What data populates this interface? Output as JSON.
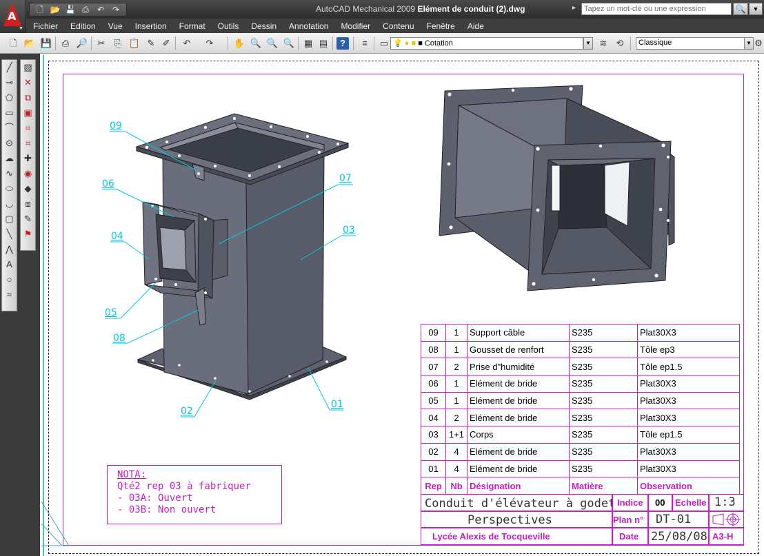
{
  "window": {
    "app_name": "AutoCAD Mechanical 2009",
    "file_name": "Elément de conduit (2).dwg",
    "search_placeholder": "Tapez un mot-clé ou une expression"
  },
  "menu": [
    "Fichier",
    "Edition",
    "Vue",
    "Insertion",
    "Format",
    "Outils",
    "Dessin",
    "Annotation",
    "Modifier",
    "Contenu",
    "Fenêtre",
    "Aide"
  ],
  "toolbar": {
    "layer_combo": "Cotation",
    "style_combo": "Classique"
  },
  "callouts": [
    "09",
    "06",
    "04",
    "05",
    "08",
    "07",
    "03",
    "02",
    "01"
  ],
  "nota": {
    "title": "NOTA:",
    "lines": [
      "Qté2 rep 03 à fabriquer",
      "- 03A: Ouvert",
      "- 03B: Non ouvert"
    ]
  },
  "bom": {
    "rows": [
      {
        "rep": "09",
        "nb": "1",
        "designation": "Support câble",
        "matiere": "S235",
        "observation": "Plat30X3"
      },
      {
        "rep": "08",
        "nb": "1",
        "designation": "Gousset de renfort",
        "matiere": "S235",
        "observation": "Tôle ep3"
      },
      {
        "rep": "07",
        "nb": "2",
        "designation": "Prise d\"humidité",
        "matiere": "S235",
        "observation": "Tôle ep1.5"
      },
      {
        "rep": "06",
        "nb": "1",
        "designation": "Elément de bride",
        "matiere": "S235",
        "observation": "Plat30X3"
      },
      {
        "rep": "05",
        "nb": "1",
        "designation": "Elément de bride",
        "matiere": "S235",
        "observation": "Plat30X3"
      },
      {
        "rep": "04",
        "nb": "2",
        "designation": "Elément de bride",
        "matiere": "S235",
        "observation": "Plat30X3"
      },
      {
        "rep": "03",
        "nb": "1+1",
        "designation": "Corps",
        "matiere": "S235",
        "observation": "Tôle ep1.5"
      },
      {
        "rep": "02",
        "nb": "4",
        "designation": "Elément de bride",
        "matiere": "S235",
        "observation": "Plat30X3"
      },
      {
        "rep": "01",
        "nb": "4",
        "designation": "Elément de bride",
        "matiere": "S235",
        "observation": "Plat30X3"
      }
    ],
    "headers": {
      "rep": "Rep",
      "nb": "Nb",
      "designation": "Désignation",
      "matiere": "Matière",
      "observation": "Observation"
    }
  },
  "title_block": {
    "title": "Conduit d'élévateur à godets",
    "subtitle": "Perspectives",
    "school": "Lycée Alexis de Tocqueville",
    "indice_label": "Indice",
    "indice_value": "00",
    "echelle_label": "Echelle",
    "echelle_value": "1:3",
    "plan_label": "Plan n°",
    "plan_value": "DT-01",
    "date_label": "Date",
    "date_value": "25/08/08",
    "format": "A3-H"
  }
}
